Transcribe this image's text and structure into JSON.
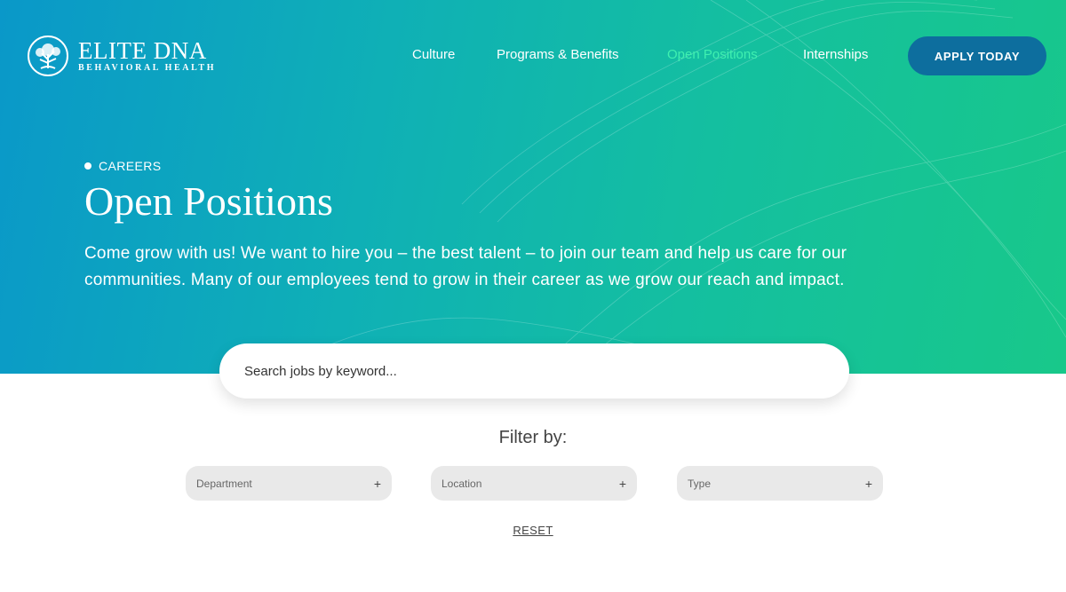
{
  "brand": {
    "name": "ELITE DNA",
    "tagline": "BEHAVIORAL HEALTH"
  },
  "nav": {
    "items": [
      {
        "label": "Culture",
        "active": false
      },
      {
        "label": "Programs & Benefits",
        "active": false
      },
      {
        "label": "Open Positions",
        "active": true
      },
      {
        "label": "Internships",
        "active": false
      }
    ],
    "cta_label": "APPLY TODAY"
  },
  "hero": {
    "eyebrow": "CAREERS",
    "title": "Open Positions",
    "intro_line_1": "Come grow with us! We want to hire you – the best talent – to join our team and help us care for our",
    "intro_line_2": "communities. Many of our employees tend to grow in their career as we grow our reach and impact."
  },
  "search": {
    "placeholder": "Search jobs by keyword...",
    "value": ""
  },
  "filters": {
    "label": "Filter by:",
    "dropdowns": [
      {
        "label": "Department",
        "icon": "plus-icon"
      },
      {
        "label": "Location",
        "icon": "plus-icon"
      },
      {
        "label": "Type",
        "icon": "plus-icon"
      }
    ],
    "reset_label": "RESET"
  },
  "colors": {
    "gradient_start": "#0a98c9",
    "gradient_end": "#18c88a",
    "nav_active": "#3ff0b0",
    "cta_bg": "#0d6e9e",
    "filter_bg": "#e9e9e9"
  }
}
